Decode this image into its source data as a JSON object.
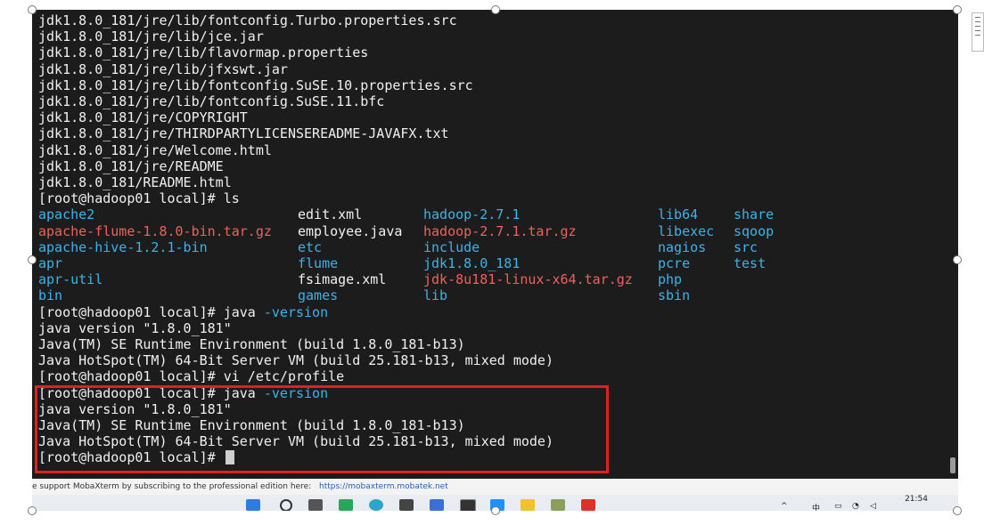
{
  "terminal": {
    "pre_lines": [
      "jdk1.8.0_181/jre/lib/fontconfig.Turbo.properties.src",
      "jdk1.8.0_181/jre/lib/jce.jar",
      "jdk1.8.0_181/jre/lib/flavormap.properties",
      "jdk1.8.0_181/jre/lib/jfxswt.jar",
      "jdk1.8.0_181/jre/lib/fontconfig.SuSE.10.properties.src",
      "jdk1.8.0_181/jre/lib/fontconfig.SuSE.11.bfc",
      "jdk1.8.0_181/jre/COPYRIGHT",
      "jdk1.8.0_181/jre/THIRDPARTYLICENSEREADME-JAVAFX.txt",
      "jdk1.8.0_181/jre/Welcome.html",
      "jdk1.8.0_181/jre/README",
      "jdk1.8.0_181/README.html",
      "[root@hadoop01 local]# ls"
    ],
    "ls_columns": [
      [
        {
          "text": "apache2",
          "kind": "dir"
        },
        {
          "text": "apache-flume-1.8.0-bin.tar.gz",
          "kind": "tar"
        },
        {
          "text": "apache-hive-1.2.1-bin",
          "kind": "dir"
        },
        {
          "text": "apr",
          "kind": "dir"
        },
        {
          "text": "apr-util",
          "kind": "dir"
        },
        {
          "text": "bin",
          "kind": "dir"
        }
      ],
      [
        {
          "text": "edit.xml",
          "kind": "file"
        },
        {
          "text": "employee.java",
          "kind": "file"
        },
        {
          "text": "etc",
          "kind": "dir"
        },
        {
          "text": "flume",
          "kind": "dir"
        },
        {
          "text": "fsimage.xml",
          "kind": "file"
        },
        {
          "text": "games",
          "kind": "dir"
        }
      ],
      [
        {
          "text": "hadoop-2.7.1",
          "kind": "dir"
        },
        {
          "text": "hadoop-2.7.1.tar.gz",
          "kind": "tar"
        },
        {
          "text": "include",
          "kind": "dir"
        },
        {
          "text": "jdk1.8.0_181",
          "kind": "dir"
        },
        {
          "text": "jdk-8u181-linux-x64.tar.gz",
          "kind": "tar"
        },
        {
          "text": "lib",
          "kind": "dir"
        }
      ],
      [
        {
          "text": "lib64",
          "kind": "dir"
        },
        {
          "text": "libexec",
          "kind": "dir"
        },
        {
          "text": "nagios",
          "kind": "dir"
        },
        {
          "text": "pcre",
          "kind": "dir"
        },
        {
          "text": "php",
          "kind": "dir"
        },
        {
          "text": "sbin",
          "kind": "dir"
        }
      ],
      [
        {
          "text": "share",
          "kind": "dir"
        },
        {
          "text": "sqoop",
          "kind": "dir"
        },
        {
          "text": "src",
          "kind": "dir"
        },
        {
          "text": "test",
          "kind": "dir"
        }
      ]
    ],
    "prompt": "[root@hadoop01 local]# ",
    "cmd_java": "java ",
    "cmd_flag": "-version",
    "out_version": "java version \"1.8.0_181\"",
    "out_runtime": "Java(TM) SE Runtime Environment (build 1.8.0_181-b13)",
    "out_vm": "Java HotSpot(TM) 64-Bit Server VM (build 25.181-b13, mixed mode)",
    "cmd_vi": "[root@hadoop01 local]# vi /etc/profile",
    "final_prompt": "[root@hadoop01 local]# "
  },
  "statusbar": {
    "message": "e support MobaXterm by subscribing to the professional edition here:",
    "link": "https://mobaxterm.mobatek.net"
  },
  "taskbar": {
    "time": "21:54"
  },
  "colors": {
    "terminal_bg": "#1c1c1c",
    "dir": "#3ab4ea",
    "tar": "#f06060",
    "text": "#f0f0f0",
    "highlight_border": "#e02020"
  }
}
